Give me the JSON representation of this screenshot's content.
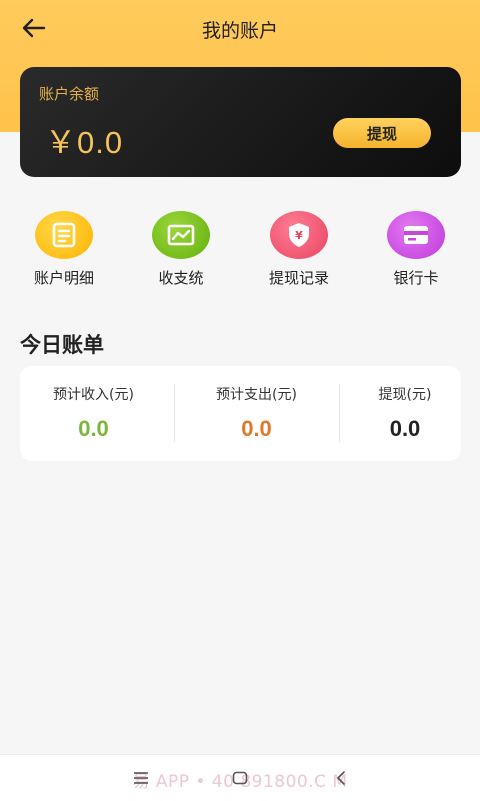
{
  "header": {
    "title": "我的账户",
    "back_icon": "arrow-left-icon"
  },
  "balance_card": {
    "label": "账户余额",
    "amount": "￥0.0",
    "withdraw_label": "提现"
  },
  "quick_actions": [
    {
      "label": "账户明细",
      "icon": "document-icon",
      "color": "#ffbf18"
    },
    {
      "label": "收支统",
      "icon": "chart-line-icon",
      "color": "#7ec21c"
    },
    {
      "label": "提现记录",
      "icon": "yuan-shield-icon",
      "color": "#f2587a"
    },
    {
      "label": "银行卡",
      "icon": "credit-card-icon",
      "color": "#cf4fe6"
    }
  ],
  "today_bill": {
    "title": "今日账单",
    "items": [
      {
        "label": "预计收入(元)",
        "value": "0.0",
        "color": "#7ab63a"
      },
      {
        "label": "预计支出(元)",
        "value": "0.0",
        "color": "#e0782a"
      },
      {
        "label": "提现(元)",
        "value": "0.0",
        "color": "#222222"
      }
    ]
  },
  "system_nav": {
    "watermark": "易   APP • 40  891800.C M",
    "icons": [
      "menu-icon",
      "home-square-icon",
      "back-chevron-icon"
    ]
  },
  "colors": {
    "header_yellow": "#ffc24a",
    "card_dark": "#111111",
    "gold_text": "#f6c35b"
  }
}
